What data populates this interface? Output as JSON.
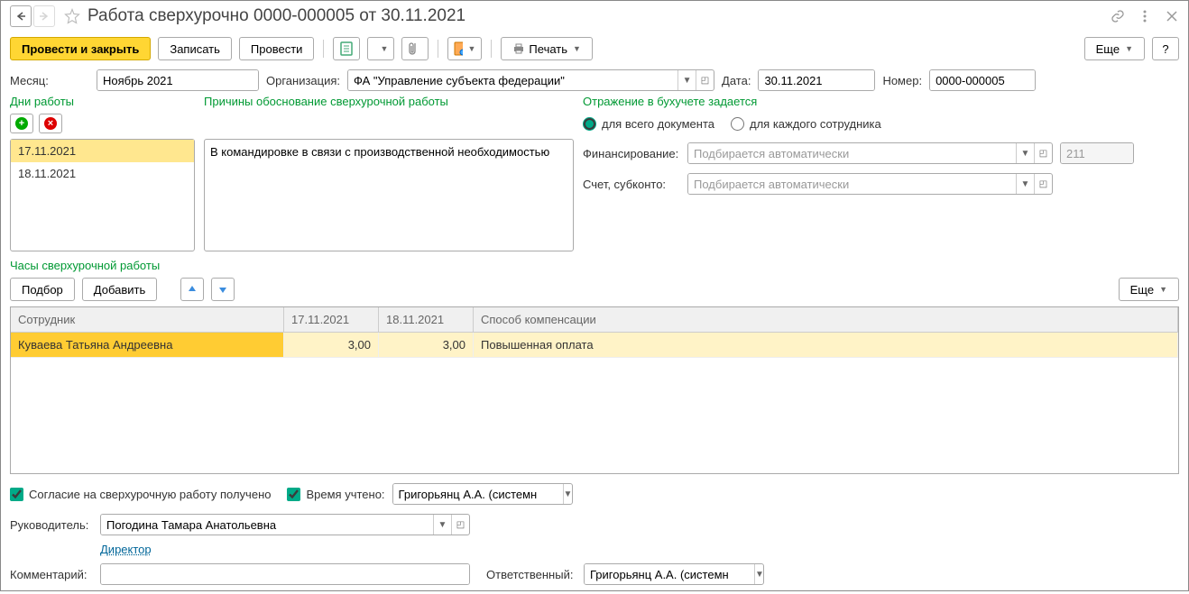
{
  "title": "Работа сверхурочно 0000-000005 от 30.11.2021",
  "toolbar": {
    "post_close": "Провести и закрыть",
    "save": "Записать",
    "post": "Провести",
    "print": "Печать",
    "more": "Еще"
  },
  "header_form": {
    "month_label": "Месяц:",
    "month_value": "Ноябрь 2021",
    "org_label": "Организация:",
    "org_value": "ФА \"Управление субъекта федерации\"",
    "date_label": "Дата:",
    "date_value": "30.11.2021",
    "number_label": "Номер:",
    "number_value": "0000-000005"
  },
  "days": {
    "label": "Дни работы",
    "items": [
      "17.11.2021",
      "18.11.2021"
    ]
  },
  "reason": {
    "label": "Причины обоснование сверхурочной работы",
    "text": "В командировке в связи с производственной необходимостью"
  },
  "accounting": {
    "header": "Отражение в бухучете задается",
    "radio_doc": "для всего документа",
    "radio_emp": "для каждого сотрудника",
    "fin_label": "Финансирование:",
    "fin_placeholder": "Подбирается автоматически",
    "fin_code": "211",
    "account_label": "Счет, субконто:",
    "account_placeholder": "Подбирается автоматически"
  },
  "hours": {
    "label": "Часы сверхурочной работы",
    "select_btn": "Подбор",
    "add_btn": "Добавить",
    "more": "Еще",
    "columns": [
      "Сотрудник",
      "17.11.2021",
      "18.11.2021",
      "Способ компенсации"
    ],
    "rows": [
      {
        "employee": "Куваева Татьяна Андреевна",
        "d1": "3,00",
        "d2": "3,00",
        "comp": "Повышенная оплата"
      }
    ]
  },
  "bottom": {
    "consent": "Согласие на сверхурочную работу получено",
    "accounted": "Время учтено:",
    "accounted_by": "Григорьянц А.А. (системн",
    "manager_label": "Руководитель:",
    "manager_value": "Погодина Тамара Анатольевна",
    "manager_link": "Директор",
    "comment_label": "Комментарий:",
    "responsible_label": "Ответственный:",
    "responsible_value": "Григорьянц А.А. (системн"
  }
}
